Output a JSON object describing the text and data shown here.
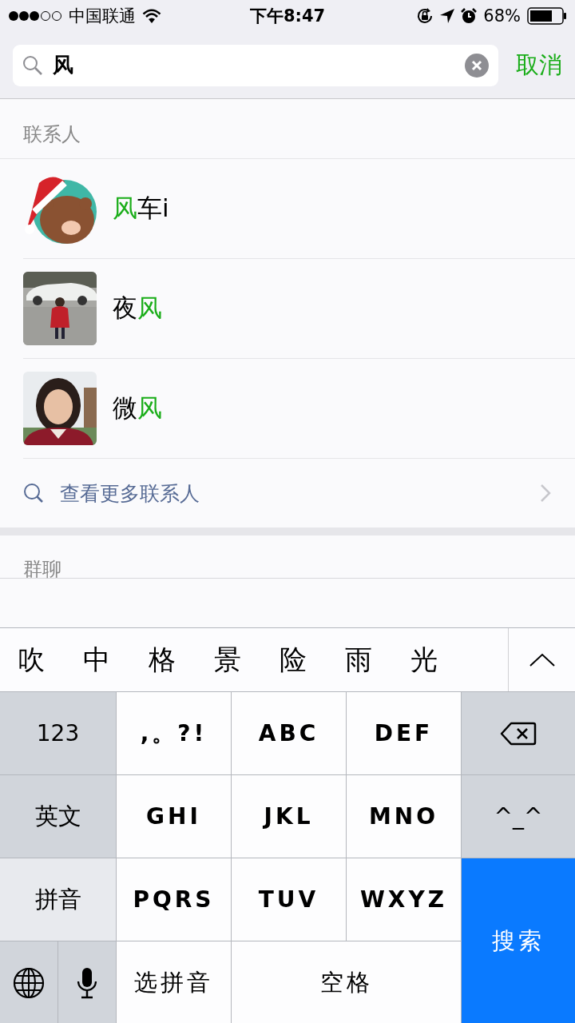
{
  "status_bar": {
    "carrier": "中国联通",
    "time": "下午8:47",
    "battery": "68%"
  },
  "search": {
    "value": "风",
    "cancel": "取消"
  },
  "contacts": {
    "title": "联系人",
    "items": [
      {
        "name": [
          {
            "text": "风",
            "match": true
          },
          {
            "text": "车i",
            "match": false
          }
        ]
      },
      {
        "name": [
          {
            "text": "夜",
            "match": false
          },
          {
            "text": "风",
            "match": true
          }
        ]
      },
      {
        "name": [
          {
            "text": "微",
            "match": false
          },
          {
            "text": "风",
            "match": true
          }
        ]
      }
    ],
    "more": "查看更多联系人"
  },
  "group_chats": {
    "title": "群聊"
  },
  "keyboard": {
    "candidates": [
      "吹",
      "中",
      "格",
      "景",
      "险",
      "雨",
      "光"
    ],
    "keys": [
      {
        "kind": "function",
        "label": "123"
      },
      {
        "kind": "letter",
        "label": ",。?!"
      },
      {
        "kind": "letter",
        "label": "ABC"
      },
      {
        "kind": "letter",
        "label": "DEF"
      },
      {
        "kind": "delete"
      },
      {
        "kind": "mode",
        "label": "英文",
        "selected": false
      },
      {
        "kind": "letter",
        "label": "GHI"
      },
      {
        "kind": "letter",
        "label": "JKL"
      },
      {
        "kind": "letter",
        "label": "MNO"
      },
      {
        "kind": "emoticon",
        "label": "^_^"
      },
      {
        "kind": "mode",
        "label": "拼音",
        "selected": true
      },
      {
        "kind": "letter",
        "label": "PQRS"
      },
      {
        "kind": "letter",
        "label": "TUV"
      },
      {
        "kind": "letter",
        "label": "WXYZ"
      },
      {
        "kind": "search",
        "label": "搜索"
      },
      {
        "kind": "globe"
      },
      {
        "kind": "voice"
      },
      {
        "kind": "letter",
        "label": "选拼音"
      },
      {
        "kind": "space",
        "label": "空格"
      }
    ]
  }
}
